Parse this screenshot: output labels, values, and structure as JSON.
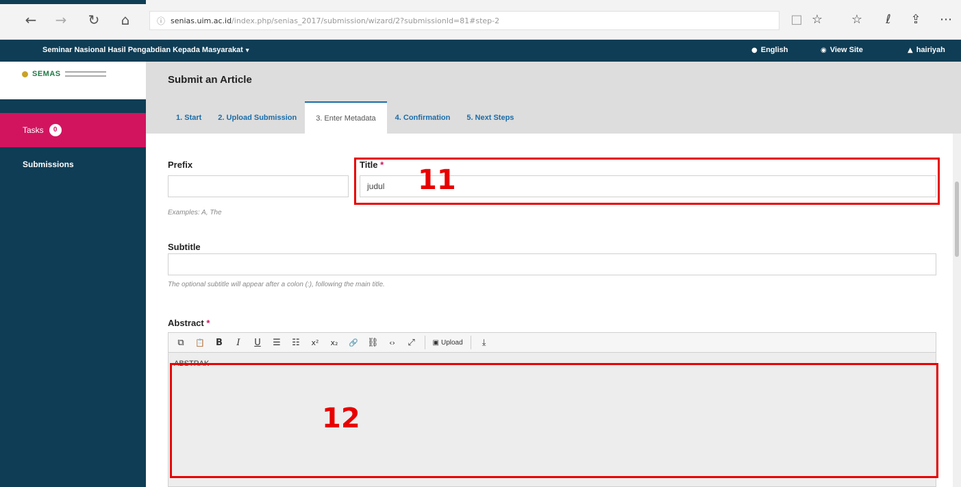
{
  "browser": {
    "back_icon": "←",
    "forward_icon": "→",
    "refresh_icon": "↻",
    "home_icon": "⌂",
    "info_icon": "ⓘ",
    "url_host": "senias.uim.ac.id",
    "url_path": "/index.php/senias_2017/submission/wizard/2?submissionId=81#step-2",
    "reading_icon": "□",
    "favorite_icon": "☆",
    "favorites_icon": "☆",
    "pen_icon": "ℓ",
    "share_icon": "⇪",
    "more_icon": "⋯"
  },
  "topbar": {
    "site_title": "Seminar Nasional Hasil Pengabdian Kepada Masyarakat",
    "caret": "▾",
    "language": "English",
    "language_icon": "●",
    "view_site": "View Site",
    "view_site_icon": "◉",
    "user": "hairiyah",
    "user_icon": "▲"
  },
  "sidebar": {
    "logo_text": "SEMAS",
    "tasks_label": "Tasks",
    "tasks_count": "0",
    "submissions_label": "Submissions"
  },
  "header": {
    "title": "Submit an Article",
    "tabs": [
      {
        "label": "1. Start"
      },
      {
        "label": "2. Upload Submission"
      },
      {
        "label": "3. Enter Metadata"
      },
      {
        "label": "4. Confirmation"
      },
      {
        "label": "5. Next Steps"
      }
    ]
  },
  "form": {
    "prefix_label": "Prefix",
    "prefix_value": "",
    "prefix_hint": "Examples: A, The",
    "title_label": "Title",
    "required_mark": "*",
    "title_value": "judul",
    "subtitle_label": "Subtitle",
    "subtitle_value": "",
    "subtitle_hint": "The optional subtitle will appear after a colon (:), following the main title.",
    "abstract_label": "Abstract",
    "abstract_value": "ABSTRAK"
  },
  "editor_toolbar": {
    "copy_icon": "⧉",
    "paste_icon": "📋",
    "bold": "B",
    "italic": "I",
    "underline": "U",
    "bullet_list_icon": "☰",
    "numbered_list_icon": "☷",
    "superscript": "x²",
    "subscript": "x₂",
    "link_icon": "🔗",
    "unlink_icon": "⛓",
    "code_icon": "‹›",
    "fullscreen_icon": "⤢",
    "image_icon": "▣",
    "upload_label": "Upload",
    "download_icon": "⤓"
  },
  "annotations": {
    "title_number": "11",
    "abstract_number": "12",
    "color": "#e80000"
  },
  "colors": {
    "nav_dark": "#0f3d55",
    "accent_pink": "#d2145f",
    "link_blue": "#1b6ca8"
  }
}
